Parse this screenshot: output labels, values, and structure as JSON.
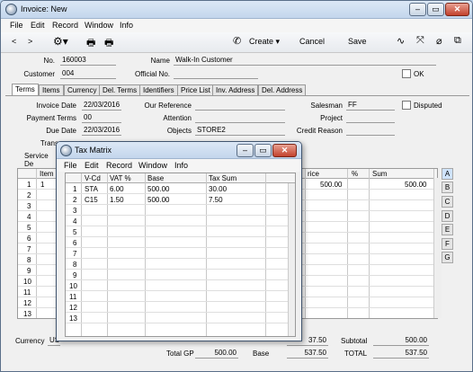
{
  "window": {
    "title": "Invoice: New"
  },
  "menu": [
    "File",
    "Edit",
    "Record",
    "Window",
    "Info"
  ],
  "toolbar": {
    "prev": "<",
    "next": ">",
    "create": "Create",
    "cancel": "Cancel",
    "save": "Save"
  },
  "header": {
    "no_label": "No.",
    "no_value": "160003",
    "name_label": "Name",
    "name_value": "Walk-In Customer",
    "customer_label": "Customer",
    "customer_value": "004",
    "official_label": "Official No.",
    "official_value": "",
    "ok_label": "OK"
  },
  "tabs": [
    "Terms",
    "Items",
    "Currency",
    "Del. Terms",
    "Identifiers",
    "Price List",
    "Inv. Address",
    "Del. Address"
  ],
  "terms": {
    "invoice_date_label": "Invoice Date",
    "invoice_date": "22/03/2016",
    "payment_terms_label": "Payment Terms",
    "payment_terms": "00",
    "due_date_label": "Due Date",
    "due_date": "22/03/2016",
    "trans_label": "Trans",
    "service_label": "Service De",
    "our_ref_label": "Our Reference",
    "our_ref": "",
    "attention_label": "Attention",
    "attention": "",
    "objects_label": "Objects",
    "objects": "STORE2",
    "salesman_label": "Salesman",
    "salesman": "FF",
    "disputed_label": "Disputed",
    "project_label": "Project",
    "project": "",
    "credit_reason_label": "Credit Reason",
    "credit_reason": ""
  },
  "grid": {
    "headers": {
      "item": "Item",
      "price": "rice",
      "pct": "%",
      "sum": "Sum"
    },
    "rows": [
      "1",
      "2",
      "3",
      "4",
      "5",
      "6",
      "7",
      "8",
      "9",
      "10",
      "11",
      "12",
      "13"
    ],
    "row1": {
      "item": "1",
      "price": "500.00",
      "sum": "500.00"
    }
  },
  "side_tabs": [
    "A",
    "B",
    "C",
    "D",
    "E",
    "F",
    "G"
  ],
  "footer": {
    "currency_label": "Currency",
    "currency_value": "US",
    "vat_value": "37.50",
    "subtotal_label": "Subtotal",
    "subtotal": "500.00",
    "total_gp_label": "Total GP",
    "total_gp": "500.00",
    "base_label": "Base",
    "base": "537.50",
    "total_label": "TOTAL",
    "total": "537.50"
  },
  "tax_matrix": {
    "title": "Tax Matrix",
    "menu": [
      "File",
      "Edit",
      "Record",
      "Window",
      "Info"
    ],
    "headers": [
      "V-Cd",
      "VAT %",
      "Base",
      "Tax Sum"
    ],
    "row_numbers": [
      "1",
      "2",
      "3",
      "4",
      "5",
      "6",
      "7",
      "8",
      "9",
      "10",
      "11",
      "12",
      "13"
    ],
    "rows": [
      [
        "STA",
        "6.00",
        "500.00",
        "30.00"
      ],
      [
        "C15",
        "1.50",
        "500.00",
        "7.50"
      ]
    ]
  }
}
